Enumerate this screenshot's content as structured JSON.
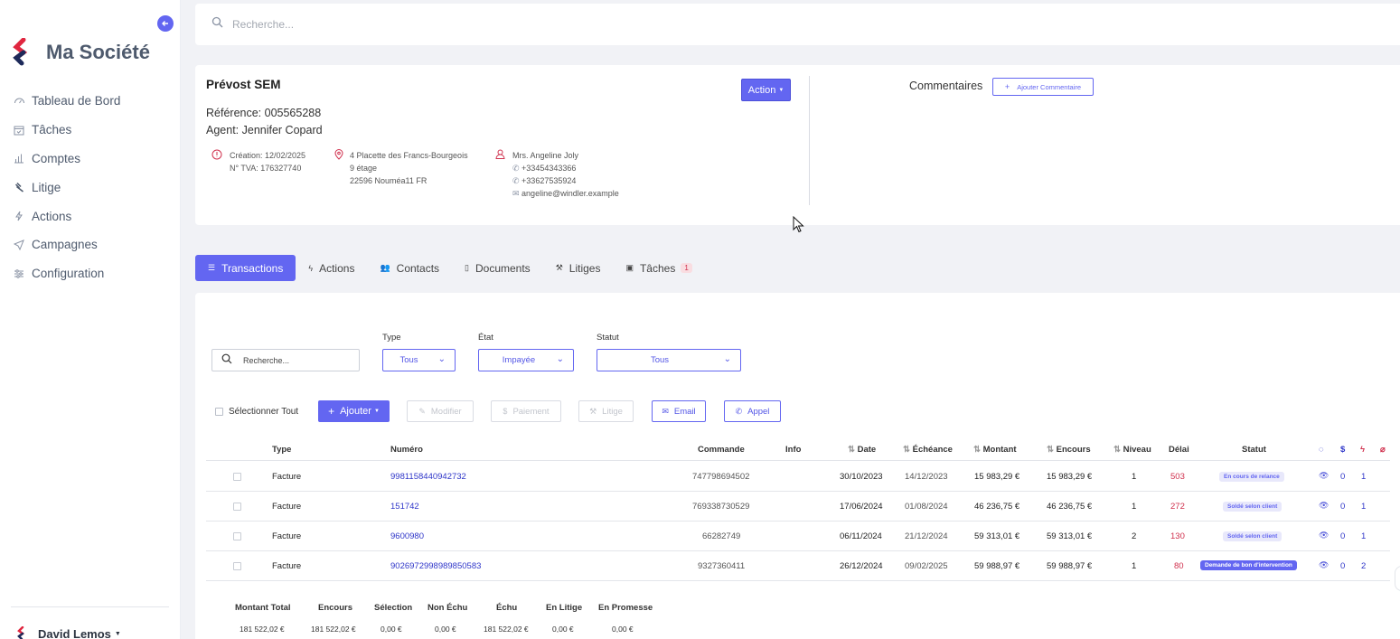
{
  "sidebar": {
    "brand": "Ma Société",
    "items": [
      {
        "label": "Tableau de Bord"
      },
      {
        "label": "Tâches"
      },
      {
        "label": "Comptes"
      },
      {
        "label": "Litige"
      },
      {
        "label": "Actions"
      },
      {
        "label": "Campagnes"
      },
      {
        "label": "Configuration"
      }
    ],
    "user": "David Lemos"
  },
  "search": {
    "placeholder": "Recherche..."
  },
  "client": {
    "name": "Prévost SEM",
    "reference": "Référence: 005565288",
    "agent": "Agent: Jennifer Copard",
    "action_label": "Action",
    "creation": "Création: 12/02/2025",
    "tva": "N° TVA: 176327740",
    "address1": "4 Placette des Francs-Bourgeois",
    "address2": "9 étage",
    "address3": "22596 Nouméa11 FR",
    "contact_name": "Mrs. Angeline Joly",
    "phone1": "+33454343366",
    "phone2": "+33627535924",
    "email": "angeline@windler.example",
    "comments_label": "Commentaires",
    "add_comment_label": "Ajouter Commentaire"
  },
  "tabs": [
    {
      "label": "Transactions"
    },
    {
      "label": "Actions"
    },
    {
      "label": "Contacts"
    },
    {
      "label": "Documents"
    },
    {
      "label": "Litiges"
    },
    {
      "label": "Tâches",
      "badge": "1"
    }
  ],
  "filters": {
    "search_placeholder": "Recherche...",
    "type_label": "Type",
    "type_value": "Tous",
    "etat_label": "État",
    "etat_value": "Impayée",
    "statut_label": "Statut",
    "statut_value": "Tous"
  },
  "toolbar": {
    "select_all": "Sélectionner Tout",
    "add": "Ajouter",
    "modify": "Modifier",
    "payment": "Paiement",
    "dispute": "Litige",
    "email": "Email",
    "call": "Appel"
  },
  "table": {
    "headers": {
      "type": "Type",
      "numero": "Numéro",
      "commande": "Commande",
      "info": "Info",
      "date": "Date",
      "echeance": "Échéance",
      "montant": "Montant",
      "encours": "Encours",
      "niveau": "Niveau",
      "delai": "Délai",
      "statut": "Statut"
    },
    "rows": [
      {
        "type": "Facture",
        "numero": "9981158440942732",
        "commande": "747798694502",
        "date": "30/10/2023",
        "echeance": "14/12/2023",
        "montant": "15 983,29 €",
        "encours": "15 983,29 €",
        "niveau": "1",
        "delai": "503",
        "statut": "En cours de relance",
        "c1": "0",
        "c2": "1"
      },
      {
        "type": "Facture",
        "numero": "151742",
        "commande": "769338730529",
        "date": "17/06/2024",
        "echeance": "01/08/2024",
        "montant": "46 236,75 €",
        "encours": "46 236,75 €",
        "niveau": "1",
        "delai": "272",
        "statut": "Soldé selon client",
        "c1": "0",
        "c2": "1"
      },
      {
        "type": "Facture",
        "numero": "9600980",
        "commande": "66282749",
        "date": "06/11/2024",
        "echeance": "21/12/2024",
        "montant": "59 313,01 €",
        "encours": "59 313,01 €",
        "niveau": "2",
        "delai": "130",
        "statut": "Soldé selon client",
        "c1": "0",
        "c2": "1"
      },
      {
        "type": "Facture",
        "numero": "9026972998989850583",
        "commande": "9327360411",
        "date": "26/12/2024",
        "echeance": "09/02/2025",
        "montant": "59 988,97 €",
        "encours": "59 988,97 €",
        "niveau": "1",
        "delai": "80",
        "statut": "Demande de bon d'intervention",
        "c1": "0",
        "c2": "2"
      }
    ]
  },
  "totals": {
    "labels": [
      "Montant Total",
      "Encours",
      "Sélection",
      "Non Échu",
      "Échu",
      "En Litige",
      "En Promesse"
    ],
    "values": [
      "181 522,02 €",
      "181 522,02 €",
      "0,00 €",
      "0,00 €",
      "181 522,02 €",
      "0,00 €",
      "0,00 €"
    ]
  },
  "colors": {
    "accent": "#6366f1",
    "danger": "#d0304d",
    "link": "#2f36c9"
  }
}
